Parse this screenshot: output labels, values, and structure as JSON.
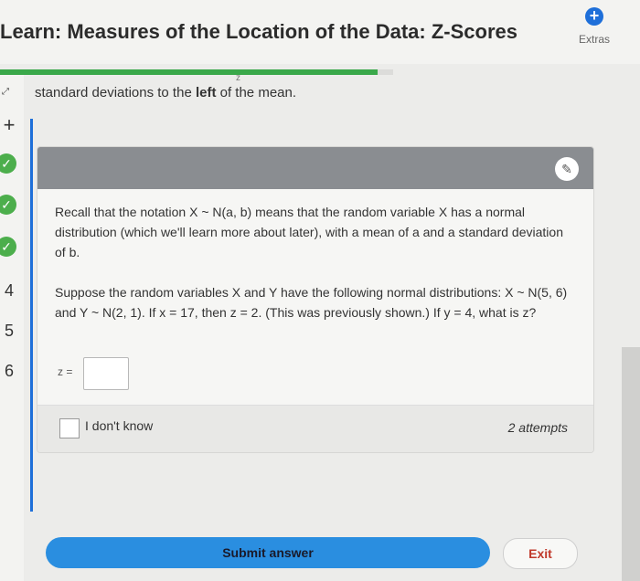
{
  "header": {
    "title": "Learn: Measures of the Location of the Data: Z-Scores",
    "extras_label": "Extras",
    "progress_fraction": 0.96
  },
  "previous": {
    "text_pre": "standard deviations to the ",
    "text_bold": "left",
    "text_post": " of the mean.",
    "partial_mark": "z"
  },
  "rail": {
    "add_label": "+",
    "items": [
      "4",
      "5",
      "6"
    ]
  },
  "question": {
    "para1": "Recall that the notation X ~ N(a, b) means that the random variable X has a normal distribution (which we'll learn more about later), with a mean of a and a standard deviation of b.",
    "para2": "Suppose the random variables X and Y have the following normal distributions: X ~ N(5, 6) and Y ~ N(2, 1). If x = 17, then z = 2. (This was previously shown.) If y = 4, what is z?",
    "answer_label": "z =",
    "answer_value": ""
  },
  "footer": {
    "idk_label": "I don't know",
    "attempts": "2 attempts"
  },
  "actions": {
    "submit_label": "Submit answer",
    "exit_label": "Exit"
  },
  "colors": {
    "accent": "#1e6fd9",
    "progress": "#3aa84a",
    "success": "#4cae4c",
    "exit": "#c0392b"
  },
  "icons": [
    "plus-circle-icon",
    "check-icon",
    "pencil-icon",
    "expand-icon"
  ]
}
